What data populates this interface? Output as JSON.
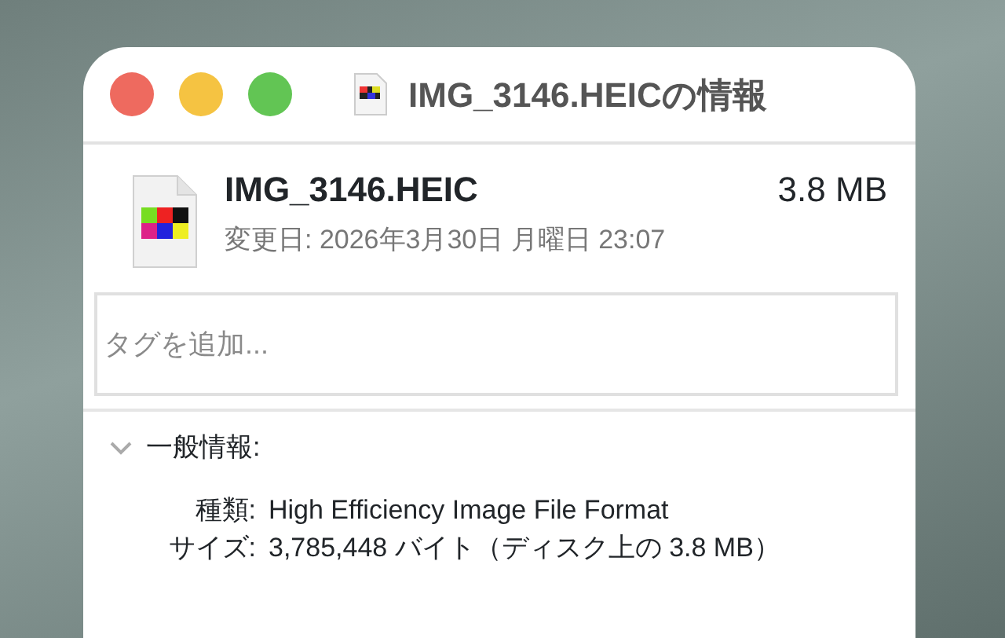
{
  "window": {
    "title": "IMG_3146.HEICの情報"
  },
  "file": {
    "name": "IMG_3146.HEIC",
    "size": "3.8 MB",
    "modified": "変更日: 2026年3月30日 月曜日 23:07"
  },
  "tags": {
    "placeholder": "タグを追加..."
  },
  "general": {
    "title": "一般情報:",
    "expanded": true,
    "rows": [
      {
        "label": "種類:",
        "value": "High Efficiency Image File Format"
      },
      {
        "label": "サイズ:",
        "value": "3,785,448 バイト（ディスク上の 3.8 MB）"
      }
    ]
  }
}
